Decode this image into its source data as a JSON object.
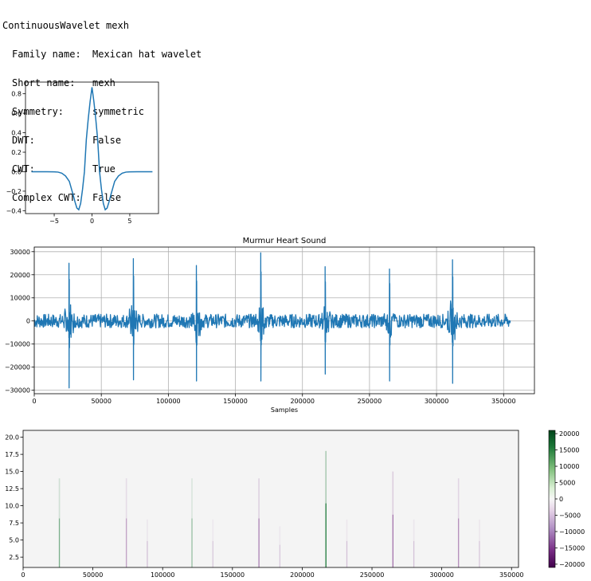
{
  "info": {
    "header": "ContinuousWavelet mexh",
    "rows": [
      {
        "key": "Family name:",
        "value": "Mexican hat wavelet"
      },
      {
        "key": "Short name:",
        "value": "mexh"
      },
      {
        "key": "Symmetry:",
        "value": "symmetric"
      },
      {
        "key": "DWT:",
        "value": "False"
      },
      {
        "key": "CWT:",
        "value": "True"
      },
      {
        "key": "Complex CWT:",
        "value": "False"
      }
    ]
  },
  "colors": {
    "line": "#1f77b4",
    "grid": "#b0b0b0",
    "heat_background": "#f4f4f4",
    "heat_positive": "#1b7837",
    "heat_negative": "#762a83"
  },
  "chart_data": [
    {
      "type": "line",
      "title": "",
      "xlabel": "",
      "ylabel": "",
      "xlim": [
        -8.8,
        8.8
      ],
      "ylim": [
        -0.43,
        0.92
      ],
      "xticks": [
        -5,
        0,
        5
      ],
      "xtick_labels": [
        "−5",
        "0",
        "5"
      ],
      "yticks": [
        0.8,
        0.6,
        0.4,
        0.2,
        0.0,
        -0.2,
        -0.4
      ],
      "ytick_labels": [
        "0.8",
        "0.6",
        "0.4",
        "0.2",
        "0.0",
        "−0.2",
        "−0.4"
      ],
      "grid": false,
      "series": [
        {
          "x": [
            -8,
            -7,
            -6,
            -5,
            -4.5,
            -4,
            -3.5,
            -3,
            -2.5,
            -2.25,
            -2,
            -1.75,
            -1.5,
            -1.25,
            -1,
            -0.75,
            -0.5,
            -0.25,
            0,
            0.25,
            0.5,
            0.75,
            1,
            1.25,
            1.5,
            1.75,
            2,
            2.25,
            2.5,
            3,
            3.5,
            4,
            4.5,
            5,
            6,
            7,
            8
          ],
          "values": [
            0,
            0,
            0,
            -0.001,
            -0.004,
            -0.015,
            -0.044,
            -0.099,
            -0.236,
            -0.31,
            -0.373,
            -0.39,
            -0.325,
            -0.18,
            0.0,
            0.33,
            0.54,
            0.72,
            0.867,
            0.72,
            0.54,
            0.33,
            0.0,
            -0.18,
            -0.325,
            -0.39,
            -0.373,
            -0.31,
            -0.236,
            -0.099,
            -0.044,
            -0.015,
            -0.004,
            -0.001,
            0,
            0,
            0
          ]
        }
      ]
    },
    {
      "type": "line",
      "title": "Murmur Heart Sound",
      "xlabel": "Samples",
      "ylabel": "",
      "xlim": [
        0,
        373000
      ],
      "ylim": [
        -31500,
        32000
      ],
      "xticks": [
        0,
        50000,
        100000,
        150000,
        200000,
        250000,
        300000,
        350000
      ],
      "xtick_labels": [
        "0",
        "50000",
        "100000",
        "150000",
        "200000",
        "250000",
        "300000",
        "350000"
      ],
      "yticks": [
        30000,
        20000,
        10000,
        0,
        -10000,
        -20000,
        -30000
      ],
      "ytick_labels": [
        "30000",
        "20000",
        "10000",
        "0",
        "−10000",
        "−20000",
        "−30000"
      ],
      "grid": true,
      "signal_length": 355000,
      "beats": [
        {
          "x": 26000,
          "max": 25000,
          "min": -29000
        },
        {
          "x": 74000,
          "max": 27000,
          "min": -25500
        },
        {
          "x": 121000,
          "max": 24000,
          "min": -26000
        },
        {
          "x": 169000,
          "max": 29500,
          "min": -26000
        },
        {
          "x": 217000,
          "max": 23500,
          "min": -23000
        },
        {
          "x": 265000,
          "max": 22500,
          "min": -26000
        },
        {
          "x": 312000,
          "max": 26500,
          "min": -27000
        }
      ],
      "noise_amplitude": 3000
    },
    {
      "type": "heatmap",
      "title": "",
      "xlabel": "",
      "ylabel": "",
      "xlim": [
        0,
        355000
      ],
      "ylim": [
        1,
        21
      ],
      "xticks": [
        0,
        50000,
        100000,
        150000,
        200000,
        250000,
        300000,
        350000
      ],
      "xtick_labels": [
        "0",
        "50000",
        "100000",
        "150000",
        "200000",
        "250000",
        "300000",
        "350000"
      ],
      "yticks": [
        20.0,
        17.5,
        15.0,
        12.5,
        10.0,
        7.5,
        5.0,
        2.5
      ],
      "ytick_labels": [
        "20.0",
        "17.5",
        "15.0",
        "12.5",
        "10.0",
        "7.5",
        "5.0",
        "2.5"
      ],
      "colorbar": {
        "range": [
          -21000,
          21000
        ],
        "ticks": [
          20000,
          15000,
          10000,
          5000,
          0,
          -5000,
          -10000,
          -15000,
          -20000
        ],
        "tick_labels": [
          "20000",
          "15000",
          "10000",
          "5000",
          "0",
          "−5000",
          "−10000",
          "−15000",
          "−20000"
        ]
      },
      "streaks": [
        {
          "x": 26000,
          "height": 14,
          "value": 9000
        },
        {
          "x": 74000,
          "height": 14,
          "value": -6000
        },
        {
          "x": 89000,
          "height": 8,
          "value": -2500
        },
        {
          "x": 121000,
          "height": 14,
          "value": 6000
        },
        {
          "x": 136000,
          "height": 8,
          "value": -2000
        },
        {
          "x": 169000,
          "height": 14,
          "value": -9000
        },
        {
          "x": 184000,
          "height": 7,
          "value": -2000
        },
        {
          "x": 217000,
          "height": 18,
          "value": 20000
        },
        {
          "x": 232000,
          "height": 8,
          "value": -2500
        },
        {
          "x": 265000,
          "height": 15,
          "value": -11000
        },
        {
          "x": 280000,
          "height": 8,
          "value": -2500
        },
        {
          "x": 312000,
          "height": 14,
          "value": -8000
        },
        {
          "x": 327000,
          "height": 8,
          "value": -2000
        }
      ]
    }
  ]
}
